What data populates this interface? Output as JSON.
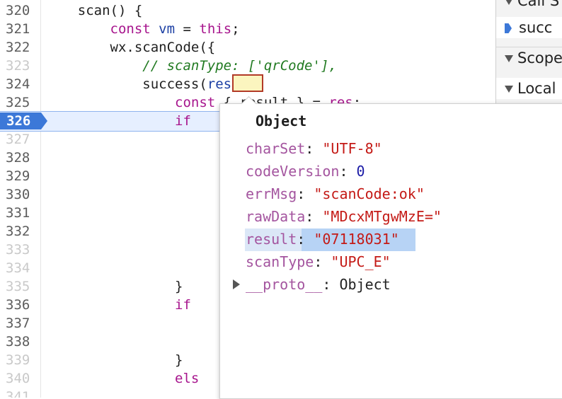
{
  "editor": {
    "lines": [
      {
        "num": "320",
        "dim": false,
        "parts": [
          {
            "t": "    scan() {",
            "c": ""
          }
        ]
      },
      {
        "num": "321",
        "dim": false,
        "parts": [
          {
            "t": "        ",
            "c": ""
          },
          {
            "t": "const",
            "c": "kw"
          },
          {
            "t": " ",
            "c": ""
          },
          {
            "t": "vm",
            "c": "var"
          },
          {
            "t": " = ",
            "c": ""
          },
          {
            "t": "this",
            "c": "kw"
          },
          {
            "t": ";",
            "c": ""
          }
        ]
      },
      {
        "num": "322",
        "dim": false,
        "parts": [
          {
            "t": "        wx.scanCode({",
            "c": ""
          }
        ]
      },
      {
        "num": "323",
        "dim": true,
        "parts": [
          {
            "t": "            ",
            "c": ""
          },
          {
            "t": "// scanType: ['qrCode'],",
            "c": "cm"
          }
        ]
      },
      {
        "num": "324",
        "dim": false,
        "parts": [
          {
            "t": "            success(",
            "c": ""
          },
          {
            "t": "res",
            "c": "var"
          },
          {
            "t": ") {",
            "c": ""
          }
        ]
      },
      {
        "num": "325",
        "dim": false,
        "parts": [
          {
            "t": "                ",
            "c": ""
          },
          {
            "t": "const",
            "c": "kw"
          },
          {
            "t": " { result } = ",
            "c": ""
          },
          {
            "t": "res",
            "c": "kw"
          },
          {
            "t": ";",
            "c": ""
          }
        ]
      },
      {
        "num": "326",
        "dim": false,
        "parts": [
          {
            "t": "                ",
            "c": ""
          },
          {
            "t": "if",
            "c": "kw"
          }
        ]
      },
      {
        "num": "327",
        "dim": true,
        "parts": []
      },
      {
        "num": "328",
        "dim": false,
        "parts": []
      },
      {
        "num": "329",
        "dim": false,
        "parts": []
      },
      {
        "num": "330",
        "dim": false,
        "parts": []
      },
      {
        "num": "331",
        "dim": false,
        "parts": []
      },
      {
        "num": "332",
        "dim": false,
        "parts": []
      },
      {
        "num": "333",
        "dim": true,
        "parts": []
      },
      {
        "num": "334",
        "dim": true,
        "parts": []
      },
      {
        "num": "335",
        "dim": true,
        "parts": [
          {
            "t": "                }",
            "c": ""
          }
        ]
      },
      {
        "num": "336",
        "dim": false,
        "parts": [
          {
            "t": "                ",
            "c": ""
          },
          {
            "t": "if",
            "c": "kw"
          }
        ]
      },
      {
        "num": "337",
        "dim": false,
        "parts": []
      },
      {
        "num": "338",
        "dim": false,
        "parts": []
      },
      {
        "num": "339",
        "dim": true,
        "parts": [
          {
            "t": "                }",
            "c": ""
          }
        ]
      },
      {
        "num": "340",
        "dim": true,
        "parts": [
          {
            "t": "                ",
            "c": ""
          },
          {
            "t": "els",
            "c": "kw"
          }
        ]
      },
      {
        "num": "341",
        "dim": true,
        "parts": []
      }
    ],
    "breakpoint_line": "326"
  },
  "sidebar": {
    "call_stack_label": "Call S",
    "current_frame": "succ",
    "scope_label": "Scope",
    "local_label": "Local"
  },
  "popup": {
    "title": "Object",
    "props": [
      {
        "key": "charSet",
        "value": "\"UTF-8\"",
        "type": "str"
      },
      {
        "key": "codeVersion",
        "value": "0",
        "type": "num"
      },
      {
        "key": "errMsg",
        "value": "\"scanCode:ok\"",
        "type": "str"
      },
      {
        "key": "rawData",
        "value": "\"MDcxMTgwMzE=\"",
        "type": "str"
      },
      {
        "key": "result",
        "value": "\"07118031\"",
        "type": "str"
      },
      {
        "key": "scanType",
        "value": "\"UPC_E\"",
        "type": "str"
      },
      {
        "key": "__proto__",
        "value": "Object",
        "type": "obj"
      }
    ]
  }
}
